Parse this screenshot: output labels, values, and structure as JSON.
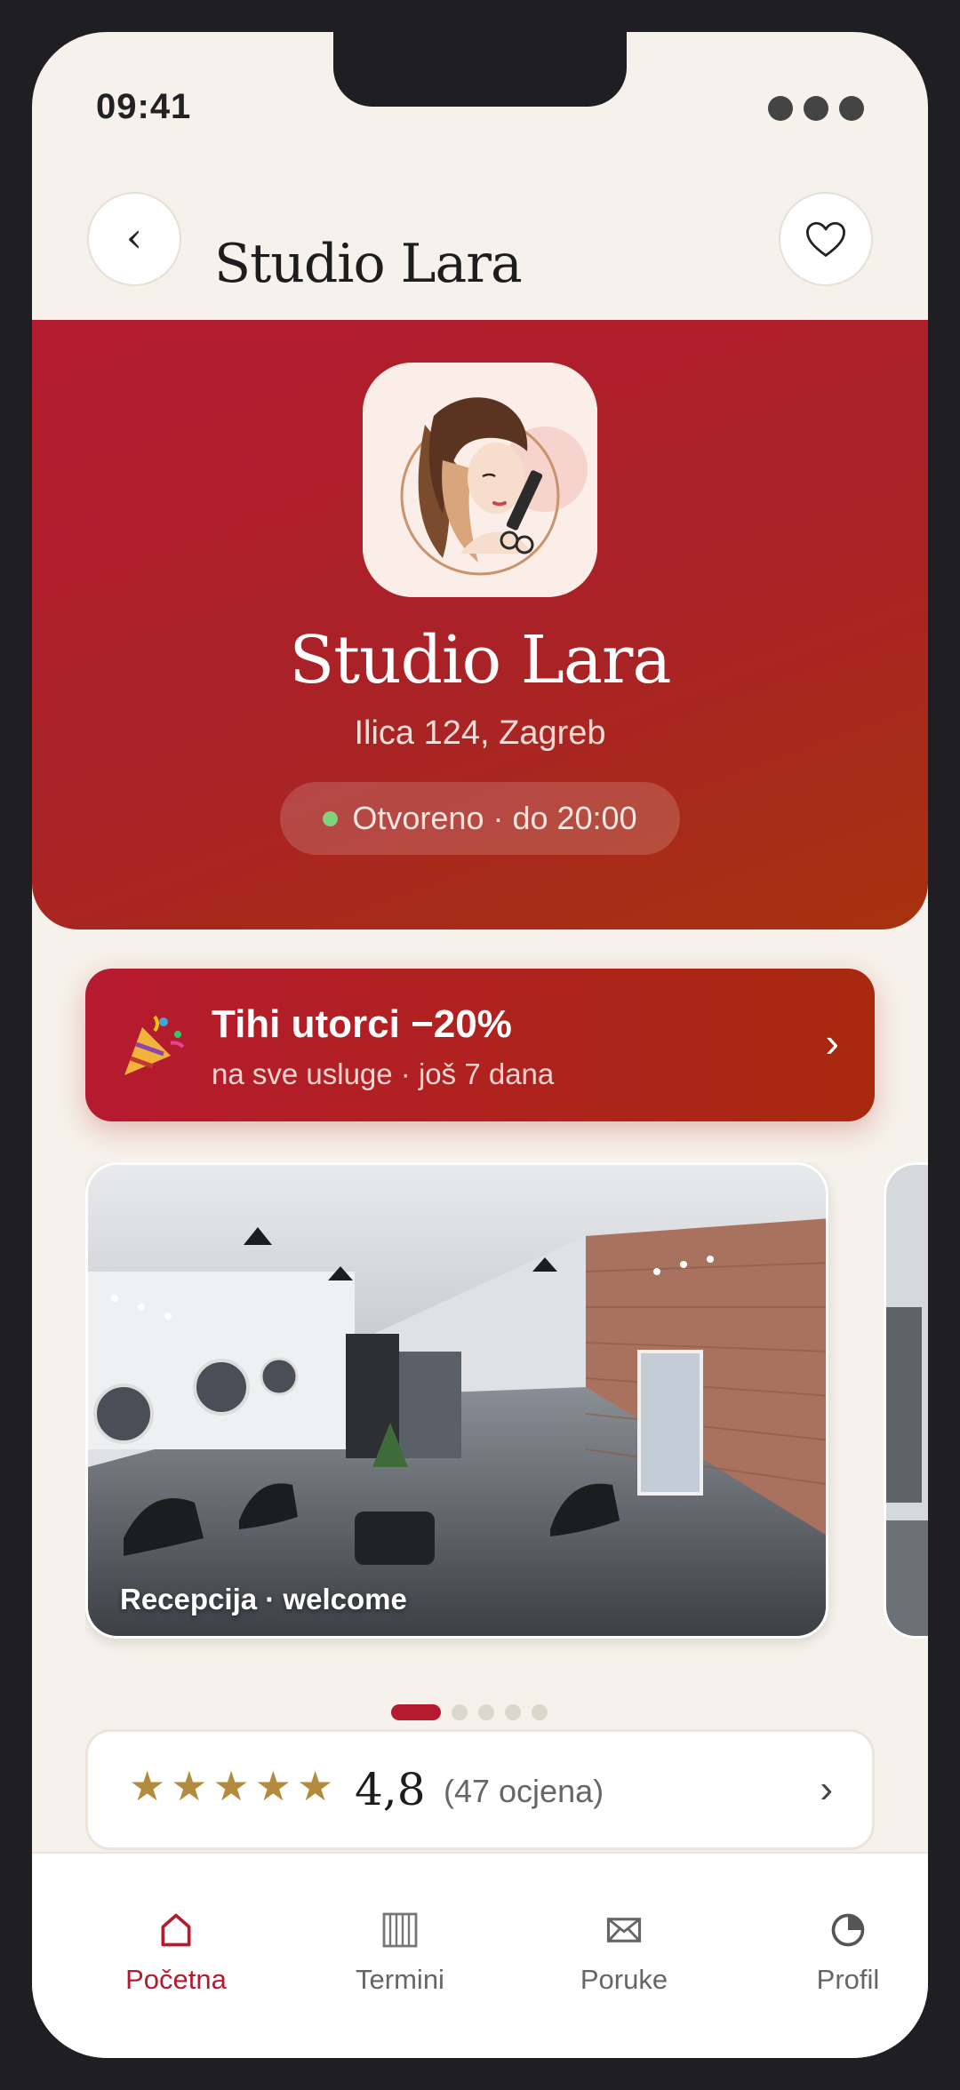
{
  "status_bar": {
    "time": "09:41"
  },
  "header": {
    "title": "Studio Lara",
    "back_icon": "chevron-left-icon",
    "favorite_icon": "heart-outline-icon"
  },
  "hero": {
    "logo": "salon-logo",
    "title": "Studio Lara",
    "address": "Ilica 124, Zagreb",
    "status": "Otvoreno · do 20:00",
    "status_color": "#7fd37a",
    "gradient_colors": [
      "#b41c30",
      "#a8320f"
    ]
  },
  "promo": {
    "icon": "party-popper-icon",
    "title": "Tihi utorci −20%",
    "subtitle": "na sve usluge · još 7 dana"
  },
  "gallery": {
    "caption": "Recepcija · welcome",
    "page_count": 5,
    "active_index": 0
  },
  "rating": {
    "stars": 5,
    "value": "4,8",
    "count": "(47 ocjena)",
    "star_color": "#b38a3e"
  },
  "tabbar": {
    "items": [
      {
        "label": "Početna",
        "icon": "home-icon",
        "active": true
      },
      {
        "label": "Termini",
        "icon": "calendar-icon",
        "active": false
      },
      {
        "label": "Poruke",
        "icon": "envelope-icon",
        "active": false
      },
      {
        "label": "Profil",
        "icon": "profile-icon",
        "active": false
      }
    ]
  },
  "colors": {
    "accent": "#b61a2f",
    "background": "#f6f1ea"
  }
}
